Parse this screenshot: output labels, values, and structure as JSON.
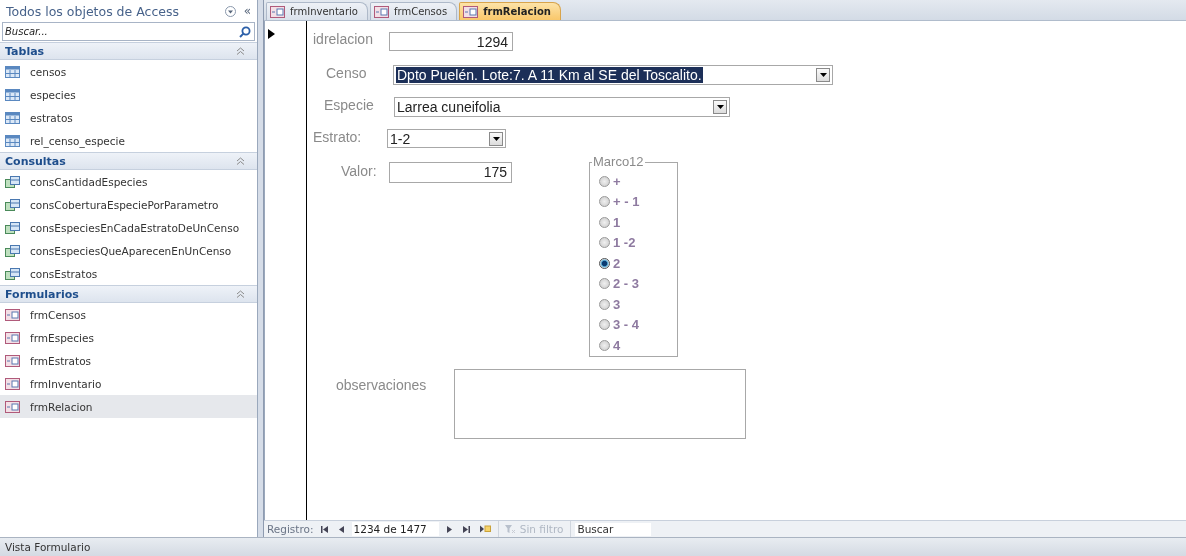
{
  "navigation_pane": {
    "title": "Todos los objetos de Access",
    "collapse_button": "«",
    "search": {
      "placeholder": "Buscar..."
    },
    "groups": [
      {
        "label": "Tablas",
        "expanded": true,
        "items": [
          {
            "label": "censos",
            "kind": "table",
            "selected": false
          },
          {
            "label": "especies",
            "kind": "table",
            "selected": false
          },
          {
            "label": "estratos",
            "kind": "table",
            "selected": false
          },
          {
            "label": "rel_censo_especie",
            "kind": "table",
            "selected": false
          }
        ]
      },
      {
        "label": "Consultas",
        "expanded": true,
        "items": [
          {
            "label": "consCantidadEspecies",
            "kind": "query",
            "selected": false
          },
          {
            "label": "consCoberturaEspeciePorParametro",
            "kind": "query",
            "selected": false
          },
          {
            "label": "consEspeciesEnCadaEstratoDeUnCenso",
            "kind": "query",
            "selected": false
          },
          {
            "label": "consEspeciesQueAparecenEnUnCenso",
            "kind": "query",
            "selected": false
          },
          {
            "label": "consEstratos",
            "kind": "query",
            "selected": false
          }
        ]
      },
      {
        "label": "Formularios",
        "expanded": true,
        "items": [
          {
            "label": "frmCensos",
            "kind": "form",
            "selected": false
          },
          {
            "label": "frmEspecies",
            "kind": "form",
            "selected": false
          },
          {
            "label": "frmEstratos",
            "kind": "form",
            "selected": false
          },
          {
            "label": "frmInventario",
            "kind": "form",
            "selected": false
          },
          {
            "label": "frmRelacion",
            "kind": "form",
            "selected": true
          }
        ]
      }
    ]
  },
  "document_tabs": [
    {
      "label": "frmInventario",
      "selected": false
    },
    {
      "label": "frmCensos",
      "selected": false
    },
    {
      "label": "frmRelacion",
      "selected": true
    }
  ],
  "form": {
    "fields": [
      {
        "kind": "textbox",
        "label": "idrelacion",
        "value": "1294"
      },
      {
        "kind": "combo",
        "label": "Censo",
        "value": "Dpto Puelén. Lote:7. A 11 Km al SE del Toscalito.",
        "text_selected": true
      },
      {
        "kind": "combo",
        "label": "Especie",
        "value": "Larrea cuneifolia",
        "text_selected": false
      },
      {
        "kind": "combo",
        "label": "Estrato:",
        "value": "1-2",
        "text_selected": false
      },
      {
        "kind": "textbox",
        "label": "Valor:",
        "value": "175"
      },
      {
        "kind": "memo",
        "label": "observaciones"
      }
    ],
    "option_group": {
      "label": "Marco12",
      "options": [
        {
          "label": "+",
          "selected": false
        },
        {
          "label": "+ - 1",
          "selected": false
        },
        {
          "label": "1",
          "selected": false
        },
        {
          "label": "1 -2",
          "selected": false
        },
        {
          "label": "2",
          "selected": true
        },
        {
          "label": "2 - 3",
          "selected": false
        },
        {
          "label": "3",
          "selected": false
        },
        {
          "label": "3 - 4",
          "selected": false
        },
        {
          "label": "4",
          "selected": false
        }
      ]
    }
  },
  "record_navigator": {
    "label": "Registro:",
    "position": "1234 de 1477",
    "filter": {
      "label": "Sin filtro",
      "active": false
    },
    "search": {
      "placeholder": "Buscar"
    }
  },
  "status_bar": {
    "text": "Vista Formulario"
  }
}
